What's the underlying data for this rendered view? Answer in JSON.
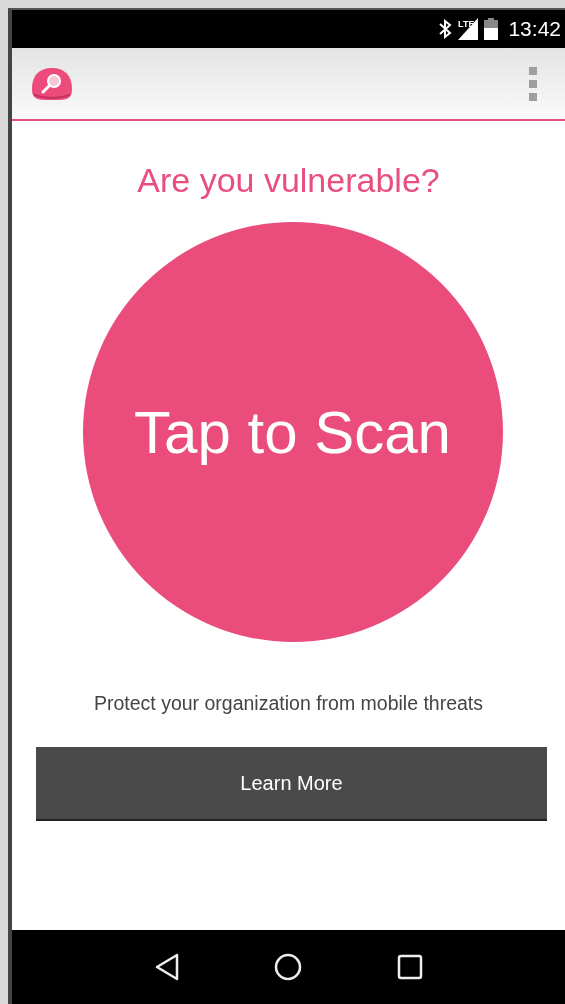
{
  "status_bar": {
    "time": "13:42",
    "network": "LTE"
  },
  "title": "Are you vulnerable?",
  "scan_button": {
    "label": "Tap to Scan"
  },
  "tagline": "Protect your organization from mobile threats",
  "learn_more_button": {
    "label": "Learn More"
  }
}
